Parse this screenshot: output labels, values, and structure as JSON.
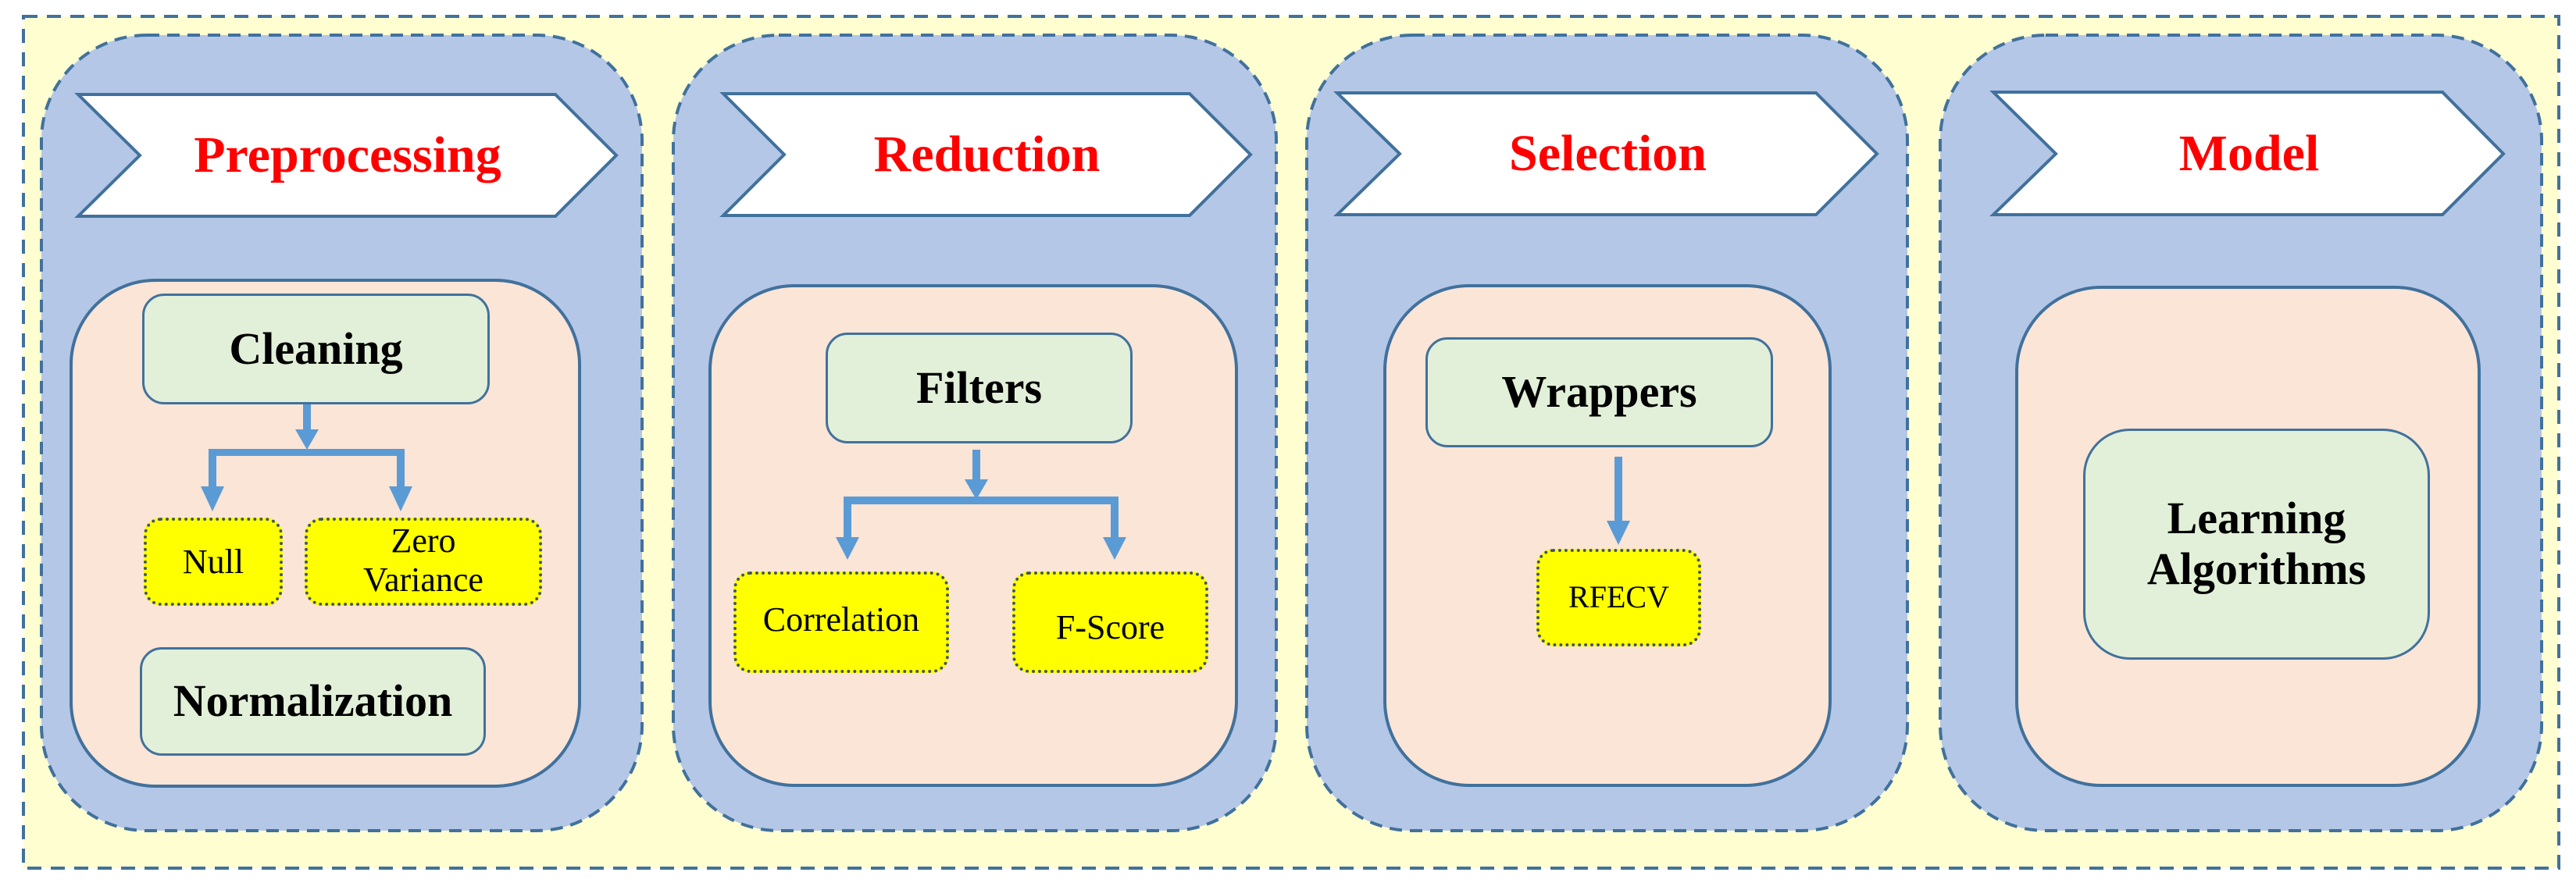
{
  "diagram": {
    "colors": {
      "canvas": "#FEFED0",
      "frame_stroke": "#41719C",
      "panel_fill": "#B4C7E7",
      "panel_stroke": "#41719C",
      "chevron_fill": "#FFFFFF",
      "title_color": "#FF0000",
      "inner_fill": "#FBE5D6",
      "method_fill": "#E2F0D9",
      "technique_fill": "#FFFF00",
      "arrow_color": "#5B9BD5"
    },
    "stages": [
      {
        "title": "Preprocessing",
        "methods": [
          "Cleaning",
          "Normalization"
        ],
        "techniques": [
          "Null",
          "Zero Variance"
        ],
        "zero_variance_lines": [
          "Zero",
          "Variance"
        ]
      },
      {
        "title": "Reduction",
        "methods": [
          "Filters"
        ],
        "techniques": [
          "Correlation",
          "F-Score"
        ]
      },
      {
        "title": "Selection",
        "methods": [
          "Wrappers"
        ],
        "techniques": [
          "RFECV"
        ]
      },
      {
        "title": "Model",
        "methods": [
          "Learning Algorithms"
        ],
        "method_lines": [
          "Learning",
          "Algorithms"
        ],
        "techniques": []
      }
    ],
    "edges": [
      {
        "from": "Cleaning",
        "to": "Null"
      },
      {
        "from": "Cleaning",
        "to": "Zero Variance"
      },
      {
        "from": "Filters",
        "to": "Correlation"
      },
      {
        "from": "Filters",
        "to": "F-Score"
      },
      {
        "from": "Wrappers",
        "to": "RFECV"
      }
    ]
  }
}
